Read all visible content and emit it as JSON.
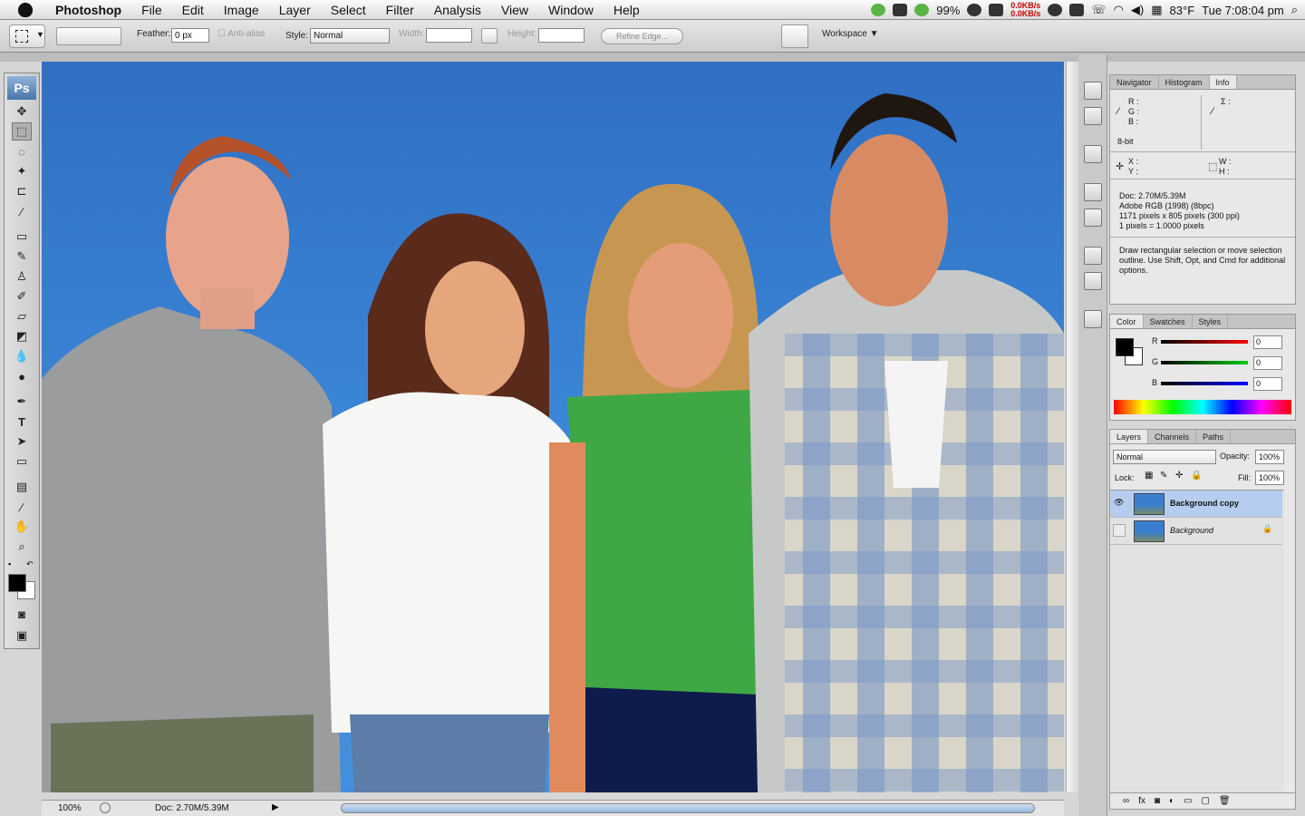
{
  "menubar": {
    "app_name": "Photoshop",
    "items": [
      "File",
      "Edit",
      "Image",
      "Layer",
      "Select",
      "Filter",
      "Analysis",
      "View",
      "Window",
      "Help"
    ],
    "battery": "99%",
    "net_up": "0.0KB/s",
    "net_down": "0.0KB/s",
    "temperature": "83°F",
    "clock": "Tue 7:08:04 pm"
  },
  "options_bar": {
    "feather_label": "Feather:",
    "feather_value": "0 px",
    "antialias_label": "Anti-alias",
    "style_label": "Style:",
    "style_value": "Normal",
    "width_label": "Width:",
    "height_label": "Height:",
    "refine_edge": "Refine Edge...",
    "workspace": "Workspace"
  },
  "toolbox": {
    "logo": "Ps"
  },
  "status_bar": {
    "zoom": "100%",
    "doc": "Doc: 2.70M/5.39M"
  },
  "info_panel": {
    "tabs": [
      "Navigator",
      "Histogram",
      "Info"
    ],
    "active_tab": "Info",
    "r_label": "R :",
    "g_label": "G :",
    "b_label": "B :",
    "sigma_label": "Σ :",
    "bit_depth": "8-bit",
    "x_label": "X :",
    "y_label": "Y :",
    "w_label": "W :",
    "h_label": "H :",
    "doc_lines": [
      "Doc: 2.70M/5.39M",
      "Adobe RGB (1998) (8bpc)",
      "1171 pixels x 805 pixels (300 ppi)",
      "1 pixels = 1.0000 pixels"
    ],
    "hint": "Draw rectangular selection or move selection outline.  Use Shift, Opt, and Cmd for additional options."
  },
  "color_panel": {
    "tabs": [
      "Color",
      "Swatches",
      "Styles"
    ],
    "r_label": "R",
    "g_label": "G",
    "b_label": "B",
    "r_value": "0",
    "g_value": "0",
    "b_value": "0"
  },
  "layers_panel": {
    "tabs": [
      "Layers",
      "Channels",
      "Paths"
    ],
    "blend_mode": "Normal",
    "opacity_label": "Opacity:",
    "opacity_value": "100%",
    "lock_label": "Lock:",
    "fill_label": "Fill:",
    "fill_value": "100%",
    "layers": [
      {
        "name": "Background copy",
        "visible": true,
        "selected": true
      },
      {
        "name": "Background",
        "visible": false,
        "selected": false
      }
    ]
  },
  "colors": {
    "canvas_blue": "#3a80d0",
    "layer_selected": "#b6cdf0",
    "ps_blue": "#4a76a8"
  }
}
